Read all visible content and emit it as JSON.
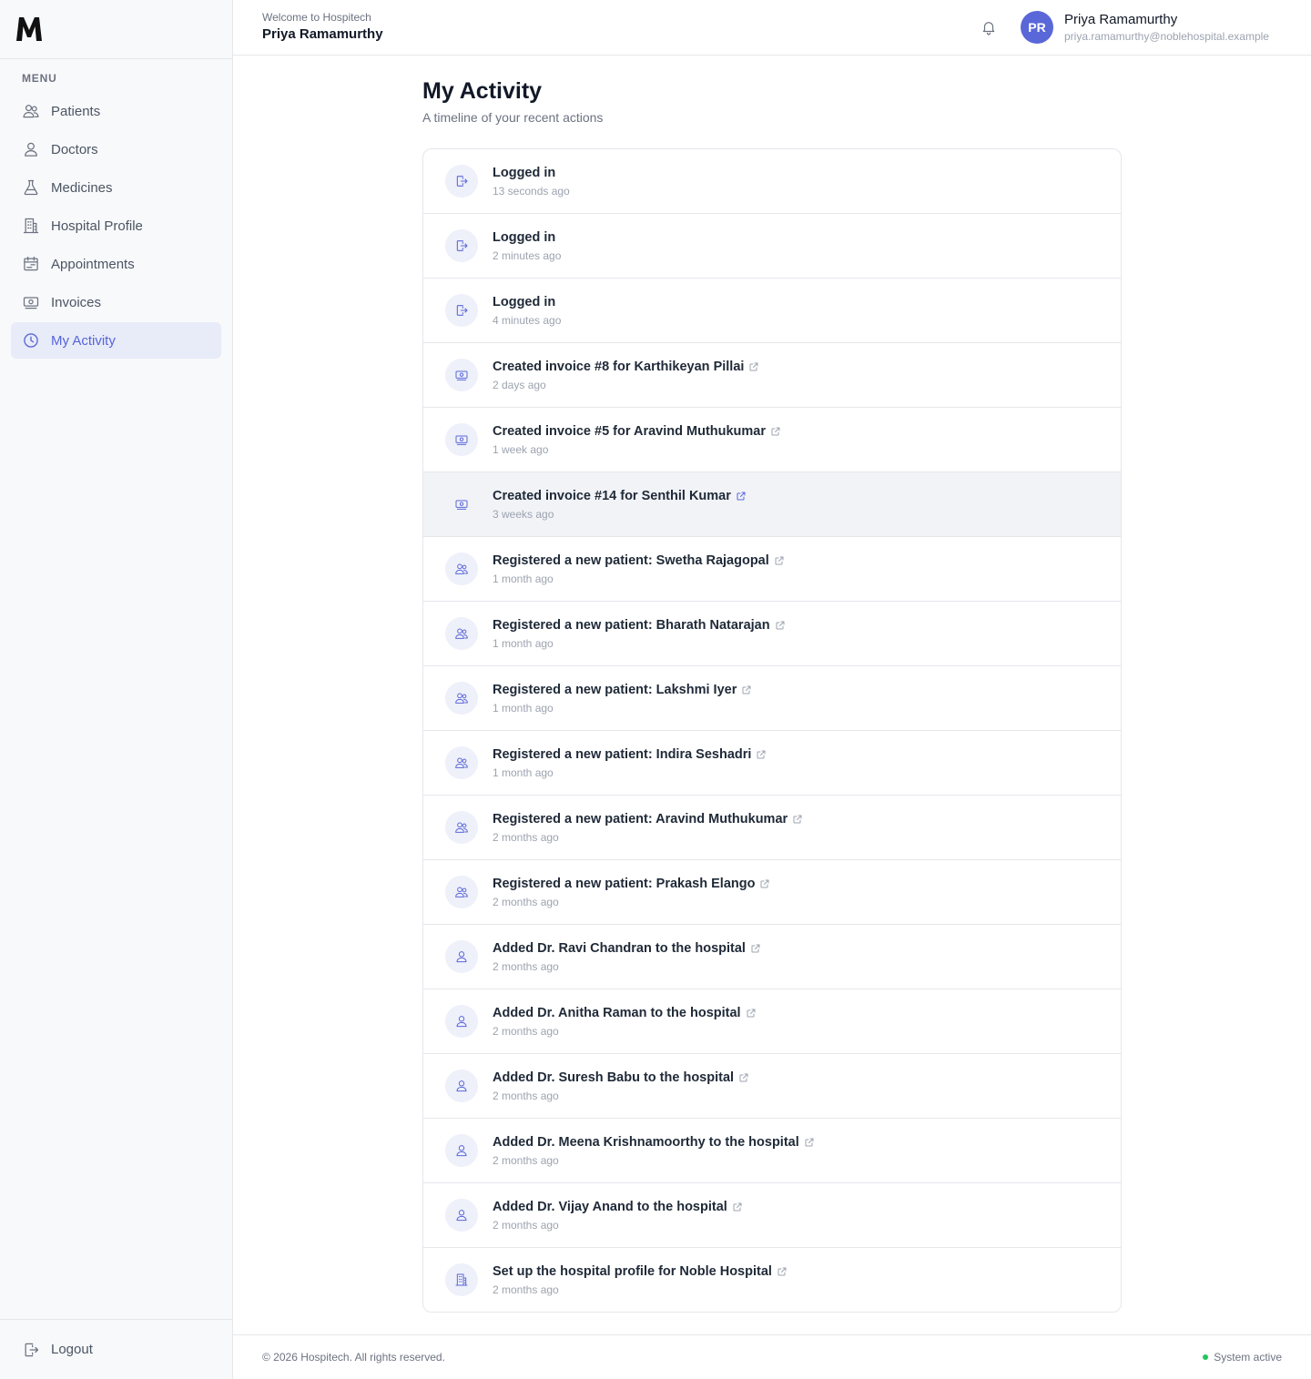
{
  "sidebar": {
    "logo": "M",
    "menu_heading": "MENU",
    "items": [
      {
        "label": "Patients",
        "icon": "users-icon"
      },
      {
        "label": "Doctors",
        "icon": "user-icon"
      },
      {
        "label": "Medicines",
        "icon": "flask-icon"
      },
      {
        "label": "Hospital Profile",
        "icon": "building-icon"
      },
      {
        "label": "Appointments",
        "icon": "calendar-icon"
      },
      {
        "label": "Invoices",
        "icon": "money-icon"
      },
      {
        "label": "My Activity",
        "icon": "clock-icon",
        "active": true
      }
    ],
    "logout_label": "Logout"
  },
  "header": {
    "welcome": "Welcome to Hospitech",
    "welcome_name": "Priya Ramamurthy",
    "avatar_initials": "PR",
    "user_name": "Priya Ramamurthy",
    "user_email": "priya.ramamurthy@noblehospital.example"
  },
  "main": {
    "title": "My Activity",
    "subtitle": "A timeline of your recent actions",
    "activities": [
      {
        "title": "Logged in",
        "time": "13 seconds ago",
        "icon": "login-icon",
        "link": false
      },
      {
        "title": "Logged in",
        "time": "2 minutes ago",
        "icon": "login-icon",
        "link": false
      },
      {
        "title": "Logged in",
        "time": "4 minutes ago",
        "icon": "login-icon",
        "link": false
      },
      {
        "title": "Created invoice #8 for Karthikeyan Pillai",
        "time": "2 days ago",
        "icon": "money-icon",
        "link": true
      },
      {
        "title": "Created invoice #5 for Aravind Muthukumar",
        "time": "1 week ago",
        "icon": "money-icon",
        "link": true
      },
      {
        "title": "Created invoice #14 for Senthil Kumar",
        "time": "3 weeks ago",
        "icon": "money-icon",
        "link": true,
        "hover": true
      },
      {
        "title": "Registered a new patient: Swetha Rajagopal",
        "time": "1 month ago",
        "icon": "users-icon",
        "link": true
      },
      {
        "title": "Registered a new patient: Bharath Natarajan",
        "time": "1 month ago",
        "icon": "users-icon",
        "link": true
      },
      {
        "title": "Registered a new patient: Lakshmi Iyer",
        "time": "1 month ago",
        "icon": "users-icon",
        "link": true
      },
      {
        "title": "Registered a new patient: Indira Seshadri",
        "time": "1 month ago",
        "icon": "users-icon",
        "link": true
      },
      {
        "title": "Registered a new patient: Aravind Muthukumar",
        "time": "2 months ago",
        "icon": "users-icon",
        "link": true
      },
      {
        "title": "Registered a new patient: Prakash Elango",
        "time": "2 months ago",
        "icon": "users-icon",
        "link": true
      },
      {
        "title": "Added Dr. Ravi Chandran to the hospital",
        "time": "2 months ago",
        "icon": "user-icon",
        "link": true
      },
      {
        "title": "Added Dr. Anitha Raman to the hospital",
        "time": "2 months ago",
        "icon": "user-icon",
        "link": true
      },
      {
        "title": "Added Dr. Suresh Babu to the hospital",
        "time": "2 months ago",
        "icon": "user-icon",
        "link": true
      },
      {
        "title": "Added Dr. Meena Krishnamoorthy to the hospital",
        "time": "2 months ago",
        "icon": "user-icon",
        "link": true
      },
      {
        "title": "Added Dr. Vijay Anand to the hospital",
        "time": "2 months ago",
        "icon": "user-icon",
        "link": true
      },
      {
        "title": "Set up the hospital profile for Noble Hospital",
        "time": "2 months ago",
        "icon": "building-icon",
        "link": true
      }
    ]
  },
  "footer": {
    "copyright": "© 2026 Hospitech. All rights reserved.",
    "status": "System active"
  },
  "colors": {
    "accent": "#5a67d8",
    "active_bg": "#e8ebf8",
    "status_ok": "#22c55e"
  }
}
